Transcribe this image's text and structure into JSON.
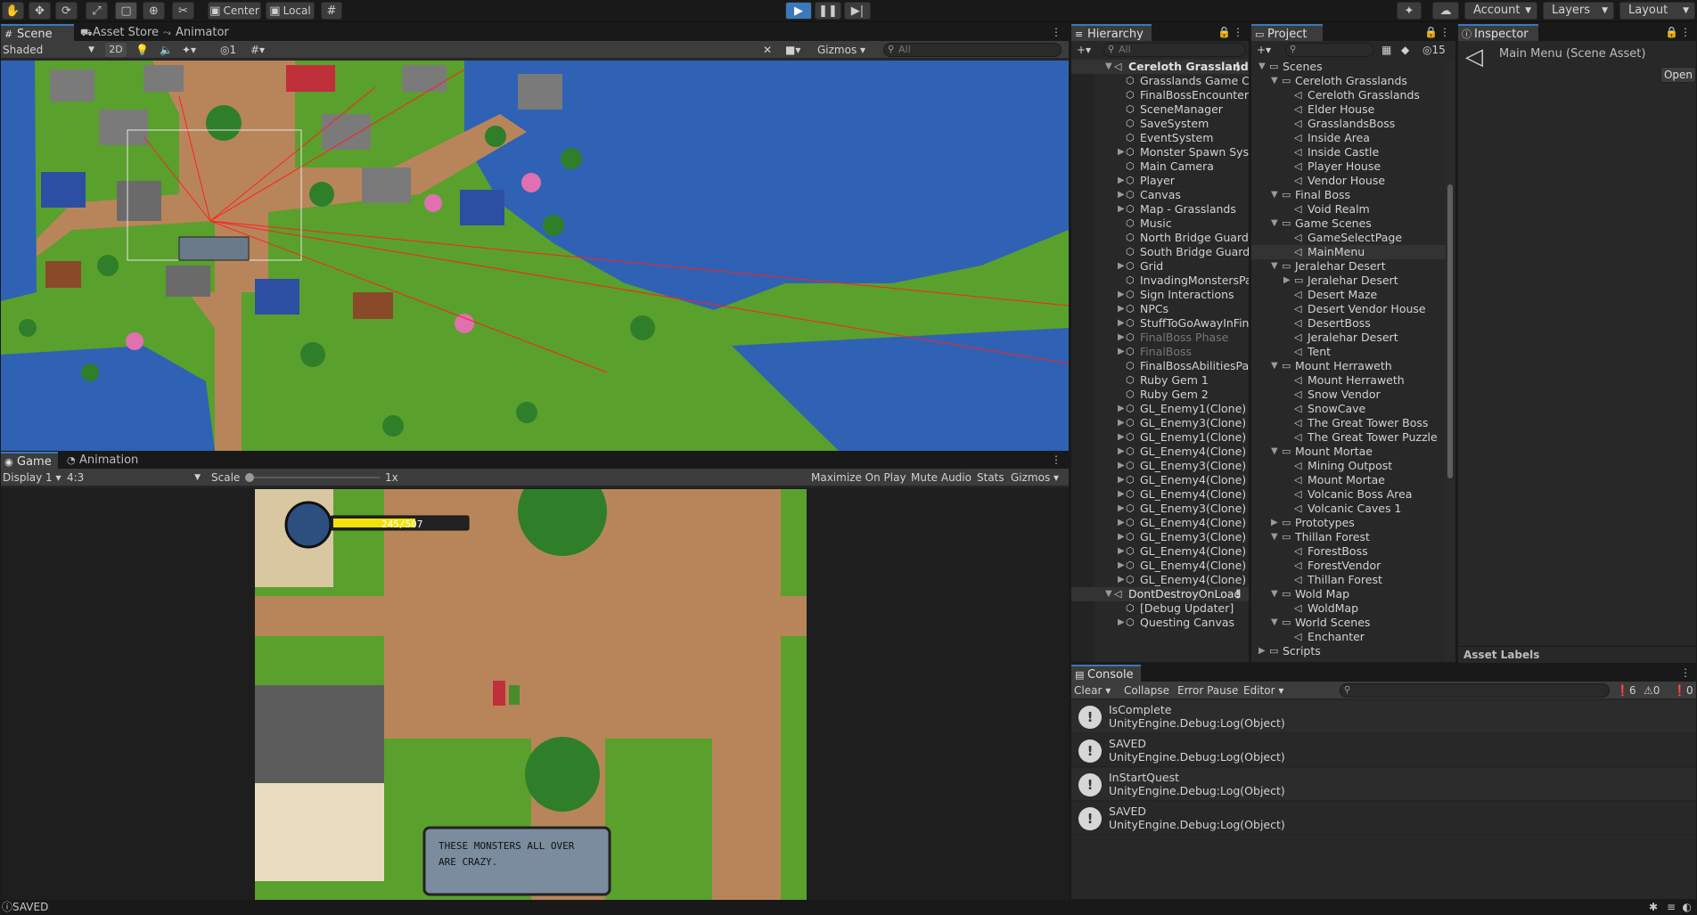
{
  "toolbar": {
    "pivot_label": "Center",
    "space_label": "Local",
    "account_label": "Account",
    "layers_label": "Layers",
    "layout_label": "Layout"
  },
  "scene_panel": {
    "tabs": {
      "scene": "Scene",
      "asset_store": "Asset Store",
      "animator": "Animator"
    },
    "shading_mode": "Shaded",
    "mode_2d": "2D",
    "hidden_count": "1",
    "gizmos_label": "Gizmos",
    "search_placeholder": "All"
  },
  "game_panel": {
    "tabs": {
      "game": "Game",
      "animation": "Animation"
    },
    "display": "Display 1",
    "aspect": "4:3",
    "scale_label": "Scale",
    "scale_value": "1x",
    "maximize_label": "Maximize On Play",
    "mute_label": "Mute Audio",
    "stats_label": "Stats",
    "gizmos_label": "Gizmos",
    "hp_text": "245/507",
    "hp_fraction": 0.62,
    "dialog_line1": "THESE MONSTERS ALL OVER",
    "dialog_line2": "ARE CRAZY."
  },
  "hierarchy": {
    "tab": "Hierarchy",
    "search_placeholder": "All",
    "scene_name": "Cereloth Grassland",
    "items": [
      {
        "label": "Grasslands Game Cor",
        "fold": false,
        "dim": false
      },
      {
        "label": "FinalBossEncounterC",
        "fold": false,
        "dim": false
      },
      {
        "label": "SceneManager",
        "fold": false,
        "dim": false
      },
      {
        "label": "SaveSystem",
        "fold": false,
        "dim": false
      },
      {
        "label": "EventSystem",
        "fold": false,
        "dim": false
      },
      {
        "label": "Monster Spawn Syste",
        "fold": true,
        "dim": false
      },
      {
        "label": "Main Camera",
        "fold": false,
        "dim": false
      },
      {
        "label": "Player",
        "fold": true,
        "dim": false
      },
      {
        "label": "Canvas",
        "fold": true,
        "dim": false
      },
      {
        "label": "Map - Grasslands",
        "fold": true,
        "dim": false
      },
      {
        "label": "Music",
        "fold": false,
        "dim": false
      },
      {
        "label": "North Bridge Guard",
        "fold": false,
        "dim": false
      },
      {
        "label": "South Bridge Guard",
        "fold": false,
        "dim": false
      },
      {
        "label": "Grid",
        "fold": true,
        "dim": false
      },
      {
        "label": "InvadingMonstersPare",
        "fold": false,
        "dim": false
      },
      {
        "label": "Sign Interactions",
        "fold": true,
        "dim": false
      },
      {
        "label": "NPCs",
        "fold": true,
        "dim": false
      },
      {
        "label": "StuffToGoAwayInFina",
        "fold": true,
        "dim": false
      },
      {
        "label": "FinalBoss Phase",
        "fold": true,
        "dim": true
      },
      {
        "label": "FinalBoss",
        "fold": true,
        "dim": true
      },
      {
        "label": "FinalBossAbilitiesPare",
        "fold": false,
        "dim": false
      },
      {
        "label": "Ruby Gem 1",
        "fold": false,
        "dim": false
      },
      {
        "label": "Ruby Gem 2",
        "fold": false,
        "dim": false
      },
      {
        "label": "GL_Enemy1(Clone)",
        "fold": true,
        "dim": false
      },
      {
        "label": "GL_Enemy3(Clone)",
        "fold": true,
        "dim": false
      },
      {
        "label": "GL_Enemy1(Clone)",
        "fold": true,
        "dim": false
      },
      {
        "label": "GL_Enemy4(Clone)",
        "fold": true,
        "dim": false
      },
      {
        "label": "GL_Enemy3(Clone)",
        "fold": true,
        "dim": false
      },
      {
        "label": "GL_Enemy4(Clone)",
        "fold": true,
        "dim": false
      },
      {
        "label": "GL_Enemy4(Clone)",
        "fold": true,
        "dim": false
      },
      {
        "label": "GL_Enemy3(Clone)",
        "fold": true,
        "dim": false
      },
      {
        "label": "GL_Enemy4(Clone)",
        "fold": true,
        "dim": false
      },
      {
        "label": "GL_Enemy3(Clone)",
        "fold": true,
        "dim": false
      },
      {
        "label": "GL_Enemy4(Clone)",
        "fold": true,
        "dim": false
      },
      {
        "label": "GL_Enemy4(Clone)",
        "fold": true,
        "dim": false
      },
      {
        "label": "GL_Enemy4(Clone)",
        "fold": true,
        "dim": false
      }
    ],
    "ddol_name": "DontDestroyOnLoad",
    "ddol_items": [
      {
        "label": "[Debug Updater]",
        "fold": false
      },
      {
        "label": "Questing Canvas",
        "fold": true
      }
    ]
  },
  "project": {
    "tab": "Project",
    "hidden_count": "15",
    "items": [
      {
        "label": "Scenes",
        "depth": 0,
        "type": "folder",
        "open": true
      },
      {
        "label": "Cereloth Grasslands",
        "depth": 1,
        "type": "folder",
        "open": true
      },
      {
        "label": "Cereloth Grasslands",
        "depth": 2,
        "type": "scene"
      },
      {
        "label": "Elder House",
        "depth": 2,
        "type": "scene"
      },
      {
        "label": "GrasslandsBoss",
        "depth": 2,
        "type": "scene"
      },
      {
        "label": "Inside Area",
        "depth": 2,
        "type": "scene"
      },
      {
        "label": "Inside Castle",
        "depth": 2,
        "type": "scene"
      },
      {
        "label": "Player House",
        "depth": 2,
        "type": "scene"
      },
      {
        "label": "Vendor House",
        "depth": 2,
        "type": "scene"
      },
      {
        "label": "Final Boss",
        "depth": 1,
        "type": "folder",
        "open": true
      },
      {
        "label": "Void Realm",
        "depth": 2,
        "type": "scene"
      },
      {
        "label": "Game Scenes",
        "depth": 1,
        "type": "folder",
        "open": true
      },
      {
        "label": "GameSelectPage",
        "depth": 2,
        "type": "scene"
      },
      {
        "label": "MainMenu",
        "depth": 2,
        "type": "scene",
        "selected": true
      },
      {
        "label": "Jeralehar Desert",
        "depth": 1,
        "type": "folder",
        "open": true
      },
      {
        "label": "Jeralehar Desert",
        "depth": 2,
        "type": "folder",
        "open": false
      },
      {
        "label": "Desert Maze",
        "depth": 2,
        "type": "scene"
      },
      {
        "label": "Desert Vendor House",
        "depth": 2,
        "type": "scene"
      },
      {
        "label": "DesertBoss",
        "depth": 2,
        "type": "scene"
      },
      {
        "label": "Jeralehar Desert",
        "depth": 2,
        "type": "scene"
      },
      {
        "label": "Tent",
        "depth": 2,
        "type": "scene"
      },
      {
        "label": "Mount Herraweth",
        "depth": 1,
        "type": "folder",
        "open": true
      },
      {
        "label": "Mount Herraweth",
        "depth": 2,
        "type": "scene"
      },
      {
        "label": "Snow Vendor",
        "depth": 2,
        "type": "scene"
      },
      {
        "label": "SnowCave",
        "depth": 2,
        "type": "scene"
      },
      {
        "label": "The Great Tower Boss",
        "depth": 2,
        "type": "scene"
      },
      {
        "label": "The Great Tower Puzzle",
        "depth": 2,
        "type": "scene"
      },
      {
        "label": "Mount Mortae",
        "depth": 1,
        "type": "folder",
        "open": true
      },
      {
        "label": "Mining Outpost",
        "depth": 2,
        "type": "scene"
      },
      {
        "label": "Mount Mortae",
        "depth": 2,
        "type": "scene"
      },
      {
        "label": "Volcanic Boss Area",
        "depth": 2,
        "type": "scene"
      },
      {
        "label": "Volcanic Caves 1",
        "depth": 2,
        "type": "scene"
      },
      {
        "label": "Prototypes",
        "depth": 1,
        "type": "folder",
        "open": false
      },
      {
        "label": "Thillan Forest",
        "depth": 1,
        "type": "folder",
        "open": true
      },
      {
        "label": "ForestBoss",
        "depth": 2,
        "type": "scene"
      },
      {
        "label": "ForestVendor",
        "depth": 2,
        "type": "scene"
      },
      {
        "label": "Thillan Forest",
        "depth": 2,
        "type": "scene"
      },
      {
        "label": "Wold Map",
        "depth": 1,
        "type": "folder",
        "open": true
      },
      {
        "label": "WoldMap",
        "depth": 2,
        "type": "scene"
      },
      {
        "label": "World Scenes",
        "depth": 1,
        "type": "folder",
        "open": true
      },
      {
        "label": "Enchanter",
        "depth": 2,
        "type": "scene"
      },
      {
        "label": "Scripts",
        "depth": 0,
        "type": "folder",
        "open": false
      }
    ]
  },
  "inspector": {
    "tab": "Inspector",
    "title": "Main Menu (Scene Asset)",
    "open_label": "Open",
    "asset_labels": "Asset Labels"
  },
  "console": {
    "tab": "Console",
    "clear": "Clear",
    "collapse": "Collapse",
    "error_pause": "Error Pause",
    "editor": "Editor",
    "info_count": "6",
    "warn_count": "0",
    "err_count": "0",
    "logs": [
      {
        "line1": "IsComplete",
        "line2": "UnityEngine.Debug:Log(Object)"
      },
      {
        "line1": "SAVED",
        "line2": "UnityEngine.Debug:Log(Object)"
      },
      {
        "line1": "InStartQuest",
        "line2": "UnityEngine.Debug:Log(Object)"
      },
      {
        "line1": "SAVED",
        "line2": "UnityEngine.Debug:Log(Object)"
      }
    ]
  },
  "status": {
    "message": "SAVED"
  },
  "colors": {
    "accent": "#3a79bb",
    "grass": "#5aa02c",
    "water": "#2f62b4",
    "path": "#b8855a",
    "hp": "#f2e20c"
  }
}
